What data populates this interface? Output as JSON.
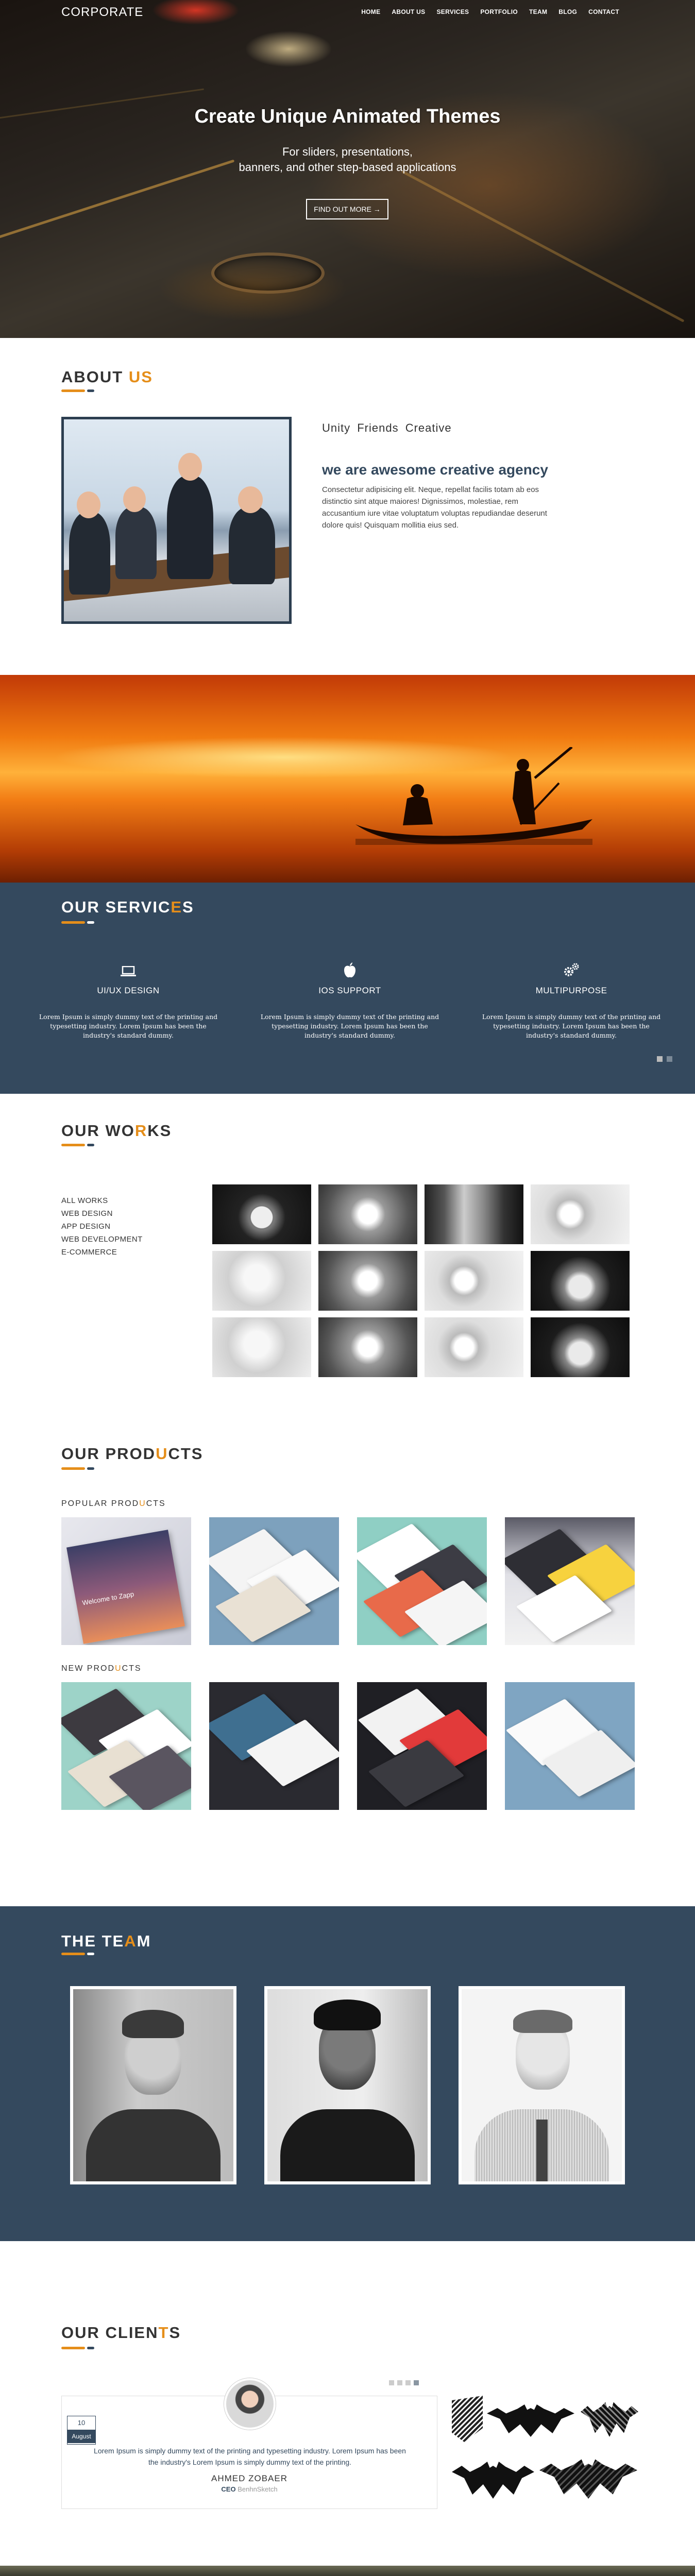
{
  "header": {
    "logo": "CORPORATE",
    "nav": [
      "HOME",
      "ABOUT US",
      "SERVICES",
      "PORTFOLIO",
      "TEAM",
      "BLOG",
      "CONTACT"
    ]
  },
  "hero": {
    "title": "Create Unique Animated Themes",
    "subtitle_line1": "For sliders, presentations,",
    "subtitle_line2": "banners, and other step-based applications",
    "cta": "FIND OUT MORE →"
  },
  "about": {
    "title_main": "ABOUT ",
    "title_accent": "US",
    "tagline": "Unity Friends Creative",
    "heading": "we are awesome creative agency",
    "paragraph": "Consectetur adipisicing elit. Neque, repellat facilis totam ab eos distinctio sint atque maiores! Dignissimos, molestiae, rem accusantium iure vitae voluptatum voluptas repudiandae deserunt dolore quis! Quisquam mollitia eius sed."
  },
  "services": {
    "title_main": "OUR SERVIC",
    "title_accent": "E",
    "title_end": "S",
    "items": [
      {
        "icon": "laptop-icon",
        "title": "UI/UX DESIGN",
        "desc": "Lorem Ipsum is simply dummy text of the printing and typesetting industry. Lorem Ipsum has been the industry's standard dummy."
      },
      {
        "icon": "apple-icon",
        "title": "IOS SUPPORT",
        "desc": "Lorem Ipsum is simply dummy text of the printing and typesetting industry. Lorem Ipsum has been the industry's standard dummy."
      },
      {
        "icon": "gears-icon",
        "title": "MULTIPURPOSE",
        "desc": "Lorem Ipsum is simply dummy text of the printing and typesetting industry. Lorem Ipsum has been the industry's standard dummy."
      }
    ]
  },
  "works": {
    "title_main": "OUR WO",
    "title_accent": "R",
    "title_end": "KS",
    "filters": [
      "ALL WORKS",
      "WEB DESIGN",
      "APP DESIGN",
      "WEB DEVELOPMENT",
      "E-COMMERCE"
    ]
  },
  "products": {
    "title_main": "OUR PROD",
    "title_accent": "U",
    "title_end": "CTS",
    "popular_main": "POPULAR PROD",
    "popular_accent": "U",
    "popular_end": "CTS",
    "new_main": "NEW PROD",
    "new_accent": "U",
    "new_end": "CTS",
    "popular_first_caption": "Welcome to Zapp"
  },
  "team": {
    "title_main": "THE TE",
    "title_accent": "A",
    "title_end": "M"
  },
  "clients": {
    "title_main": "OUR CLIEN",
    "title_accent": "T",
    "title_end": "S",
    "date_day": "10",
    "date_month": "August",
    "quote": "Lorem Ipsum is simply dummy text of the printing and typesetting industry. Lorem Ipsum has been the industry's Lorem Ipsum is simply dummy text of the printing.",
    "name": "AHMED ZOBAER",
    "role_prefix": "CEO",
    "role_company": "BenhnSketch"
  },
  "colors": {
    "accent": "#e58e1a",
    "navy": "#34495e"
  }
}
